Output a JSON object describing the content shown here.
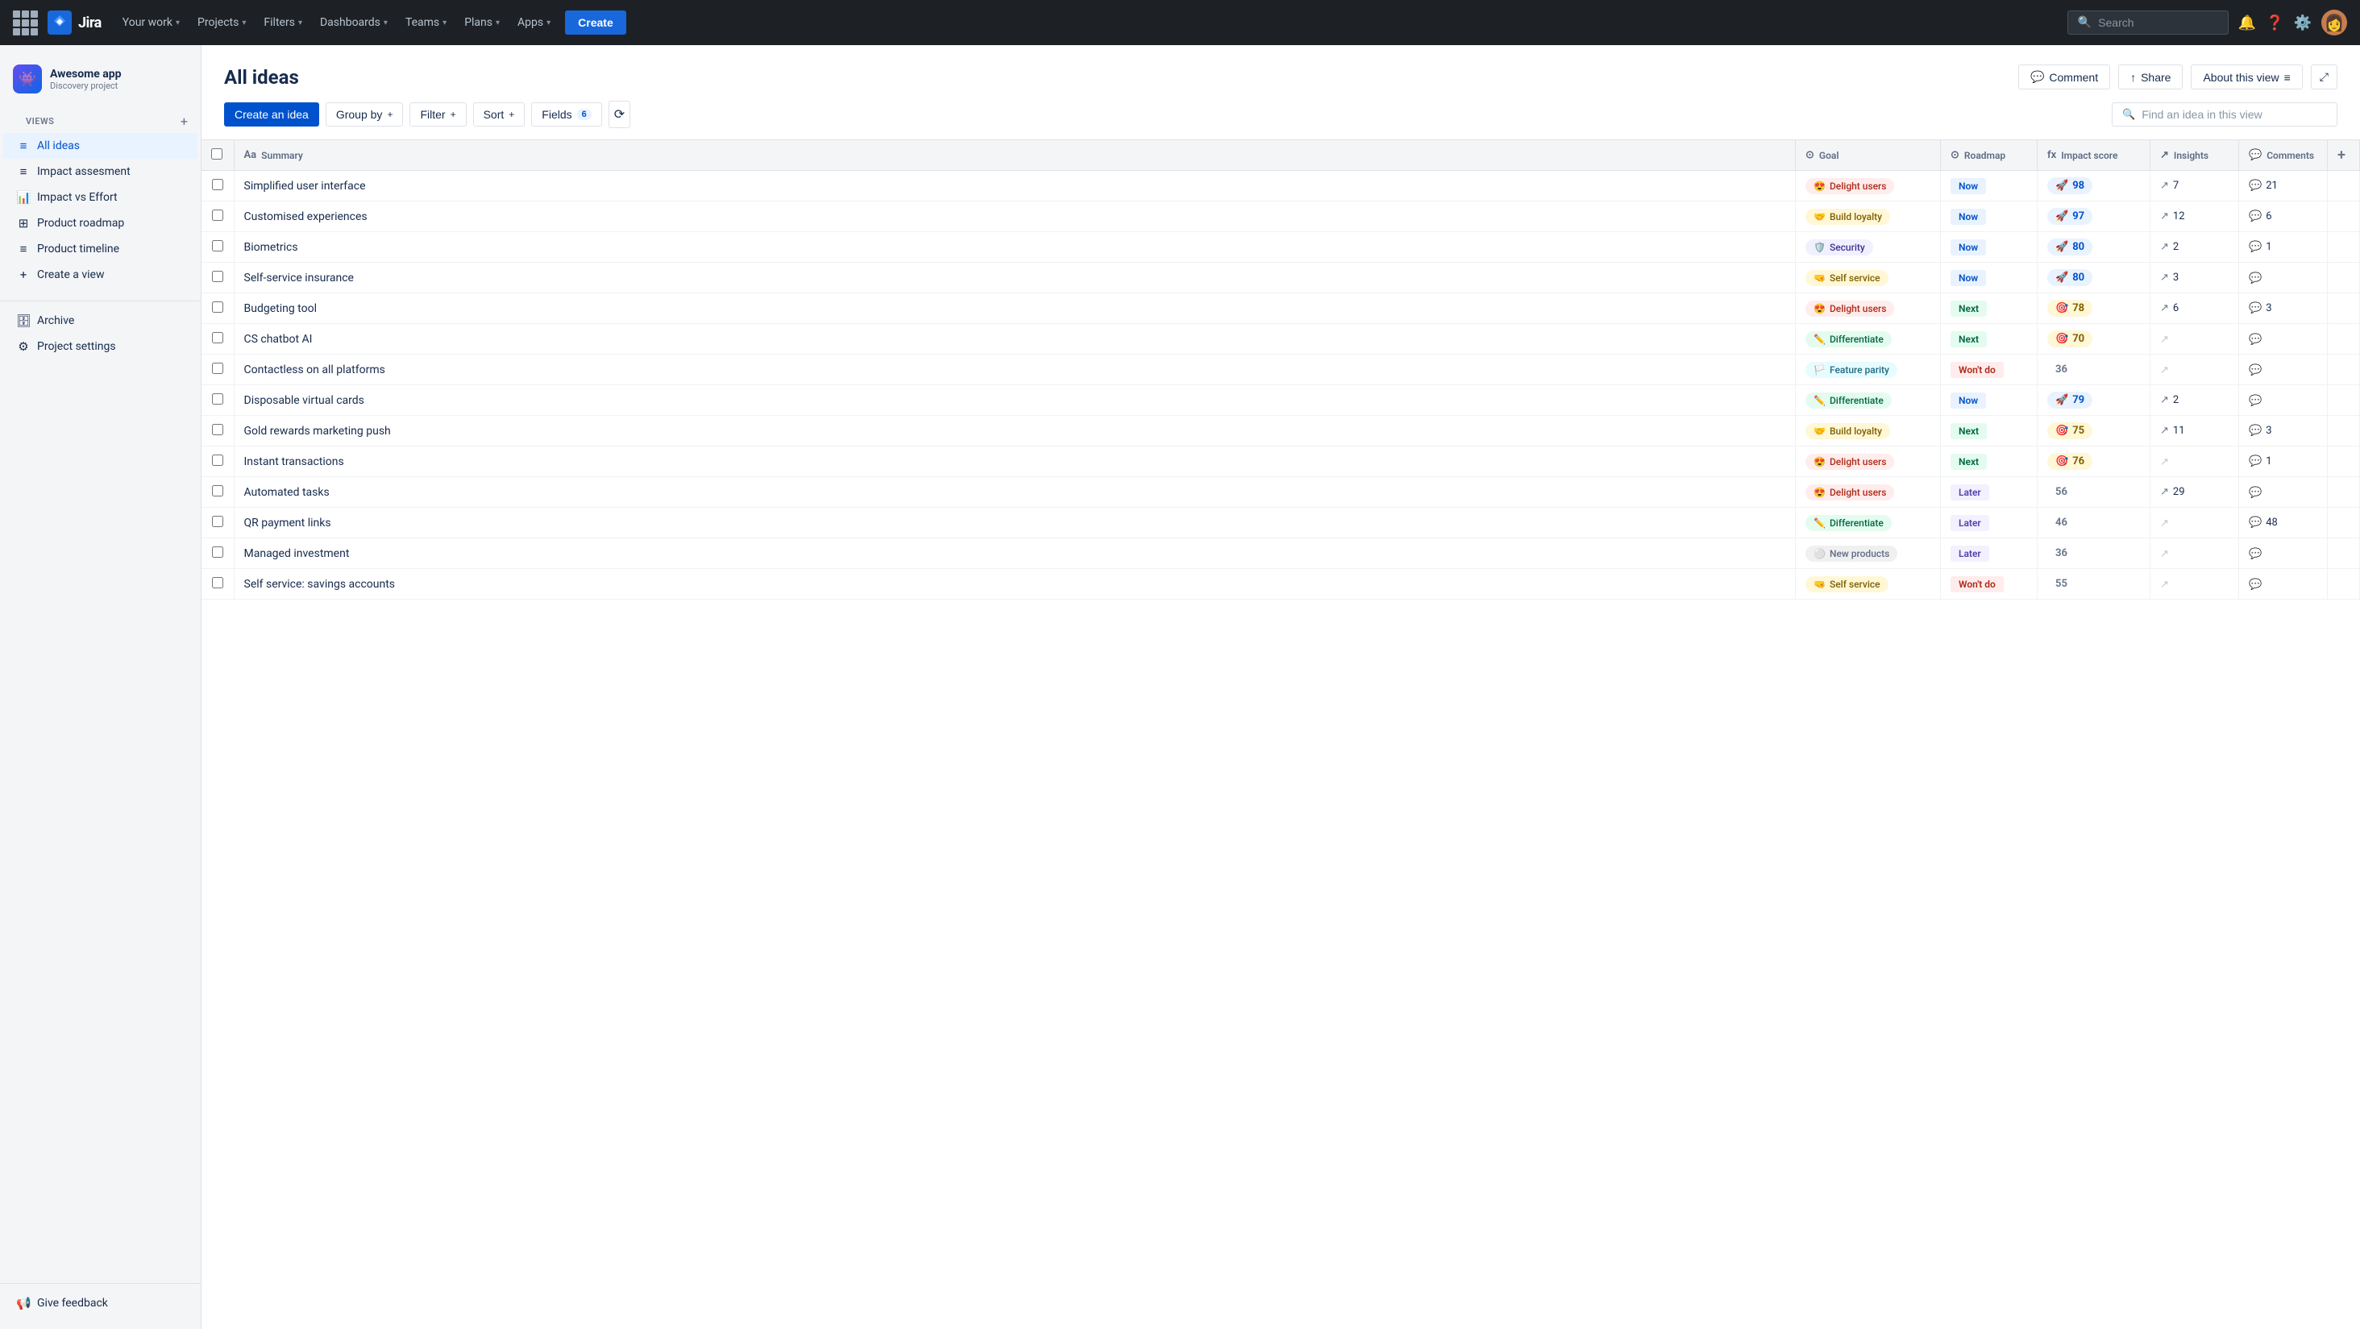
{
  "topnav": {
    "logo_text": "Jira",
    "nav_items": [
      {
        "label": "Your work",
        "chevron": true,
        "active": false
      },
      {
        "label": "Projects",
        "chevron": true,
        "active": false
      },
      {
        "label": "Filters",
        "chevron": true,
        "active": false
      },
      {
        "label": "Dashboards",
        "chevron": true,
        "active": false
      },
      {
        "label": "Teams",
        "chevron": true,
        "active": false
      },
      {
        "label": "Plans",
        "chevron": true,
        "active": false
      },
      {
        "label": "Apps",
        "chevron": true,
        "active": false
      }
    ],
    "create_label": "Create",
    "search_placeholder": "Search"
  },
  "sidebar": {
    "project_name": "Awesome app",
    "project_type": "Discovery project",
    "views_label": "VIEWS",
    "views": [
      {
        "label": "All ideas",
        "icon": "≡",
        "active": true
      },
      {
        "label": "Impact assesment",
        "icon": "≡",
        "active": false
      },
      {
        "label": "Impact vs Effort",
        "icon": "📊",
        "active": false
      },
      {
        "label": "Product roadmap",
        "icon": "⊞",
        "active": false
      },
      {
        "label": "Product timeline",
        "icon": "≡",
        "active": false
      },
      {
        "label": "Create a view",
        "icon": "+",
        "active": false
      }
    ],
    "archive_label": "Archive",
    "settings_label": "Project settings",
    "feedback_label": "Give feedback"
  },
  "main": {
    "title": "All ideas",
    "header_buttons": {
      "comment": "Comment",
      "share": "Share",
      "about": "About this view"
    },
    "toolbar": {
      "create": "Create an idea",
      "groupby": "Group by",
      "filter": "Filter",
      "sort": "Sort",
      "fields": "Fields",
      "fields_count": "6",
      "search_placeholder": "Find an idea in this view"
    },
    "table": {
      "columns": [
        {
          "label": "Summary",
          "icon": "Aa"
        },
        {
          "label": "Goal",
          "icon": "⊙"
        },
        {
          "label": "Roadmap",
          "icon": "⊙"
        },
        {
          "label": "Impact score",
          "icon": "fx"
        },
        {
          "label": "Insights",
          "icon": "↗"
        },
        {
          "label": "Comments",
          "icon": "💬"
        }
      ],
      "rows": [
        {
          "summary": "Simplified user interface",
          "goal_label": "Delight users",
          "goal_emoji": "😍",
          "goal_class": "goal-delight",
          "roadmap": "Now",
          "roadmap_class": "roadmap-now",
          "impact": 98,
          "impact_class": "impact-high",
          "impact_emoji": "🚀",
          "insights": 7,
          "comments": 21
        },
        {
          "summary": "Customised experiences",
          "goal_label": "Build loyalty",
          "goal_emoji": "🤝",
          "goal_class": "goal-loyalty",
          "roadmap": "Now",
          "roadmap_class": "roadmap-now",
          "impact": 97,
          "impact_class": "impact-high",
          "impact_emoji": "🚀",
          "insights": 12,
          "comments": 6
        },
        {
          "summary": "Biometrics",
          "goal_label": "Security",
          "goal_emoji": "🛡️",
          "goal_class": "goal-security",
          "roadmap": "Now",
          "roadmap_class": "roadmap-now",
          "impact": 80,
          "impact_class": "impact-high",
          "impact_emoji": "🚀",
          "insights": 2,
          "comments": 1
        },
        {
          "summary": "Self-service insurance",
          "goal_label": "Self service",
          "goal_emoji": "🤜",
          "goal_class": "goal-selfservice",
          "roadmap": "Now",
          "roadmap_class": "roadmap-now",
          "impact": 80,
          "impact_class": "impact-high",
          "impact_emoji": "🚀",
          "insights": 3,
          "comments": null
        },
        {
          "summary": "Budgeting tool",
          "goal_label": "Delight users",
          "goal_emoji": "😍",
          "goal_class": "goal-delight",
          "roadmap": "Next",
          "roadmap_class": "roadmap-next",
          "impact": 78,
          "impact_class": "impact-medium",
          "impact_emoji": "🎯",
          "insights": 6,
          "comments": 3
        },
        {
          "summary": "CS chatbot AI",
          "goal_label": "Differentiate",
          "goal_emoji": "✏️",
          "goal_class": "goal-differentiate",
          "roadmap": "Next",
          "roadmap_class": "roadmap-next",
          "impact": 70,
          "impact_class": "impact-medium",
          "impact_emoji": "🎯",
          "insights": null,
          "comments": null
        },
        {
          "summary": "Contactless on all platforms",
          "goal_label": "Feature parity",
          "goal_emoji": "🏳️",
          "goal_class": "goal-parity",
          "roadmap": "Won't do",
          "roadmap_class": "roadmap-wontdo",
          "impact": 36,
          "impact_class": "impact-low",
          "impact_emoji": null,
          "insights": null,
          "comments": null
        },
        {
          "summary": "Disposable virtual cards",
          "goal_label": "Differentiate",
          "goal_emoji": "✏️",
          "goal_class": "goal-differentiate",
          "roadmap": "Now",
          "roadmap_class": "roadmap-now",
          "impact": 79,
          "impact_class": "impact-high",
          "impact_emoji": "🚀",
          "insights": 2,
          "comments": null
        },
        {
          "summary": "Gold rewards marketing push",
          "goal_label": "Build loyalty",
          "goal_emoji": "🤝",
          "goal_class": "goal-loyalty",
          "roadmap": "Next",
          "roadmap_class": "roadmap-next",
          "impact": 75,
          "impact_class": "impact-medium",
          "impact_emoji": "🎯",
          "insights": 11,
          "comments": 3
        },
        {
          "summary": "Instant transactions",
          "goal_label": "Delight users",
          "goal_emoji": "😍",
          "goal_class": "goal-delight",
          "roadmap": "Next",
          "roadmap_class": "roadmap-next",
          "impact": 76,
          "impact_class": "impact-medium",
          "impact_emoji": "🎯",
          "insights": null,
          "comments": 1
        },
        {
          "summary": "Automated tasks",
          "goal_label": "Delight users",
          "goal_emoji": "😍",
          "goal_class": "goal-delight",
          "roadmap": "Later",
          "roadmap_class": "roadmap-later",
          "impact": 56,
          "impact_class": "impact-low",
          "impact_emoji": null,
          "insights": 29,
          "comments": null
        },
        {
          "summary": "QR payment links",
          "goal_label": "Differentiate",
          "goal_emoji": "✏️",
          "goal_class": "goal-differentiate",
          "roadmap": "Later",
          "roadmap_class": "roadmap-later",
          "impact": 46,
          "impact_class": "impact-low",
          "impact_emoji": null,
          "insights": null,
          "comments": 48
        },
        {
          "summary": "Managed investment",
          "goal_label": "New products",
          "goal_emoji": "⚪",
          "goal_class": "goal-newproducts",
          "roadmap": "Later",
          "roadmap_class": "roadmap-later",
          "impact": 36,
          "impact_class": "impact-low",
          "impact_emoji": null,
          "insights": null,
          "comments": null
        },
        {
          "summary": "Self service: savings accounts",
          "goal_label": "Self service",
          "goal_emoji": "🤜",
          "goal_class": "goal-selfservice",
          "roadmap": "Won't do",
          "roadmap_class": "roadmap-wontdo",
          "impact": 55,
          "impact_class": "impact-low",
          "impact_emoji": null,
          "insights": null,
          "comments": null
        }
      ]
    }
  }
}
